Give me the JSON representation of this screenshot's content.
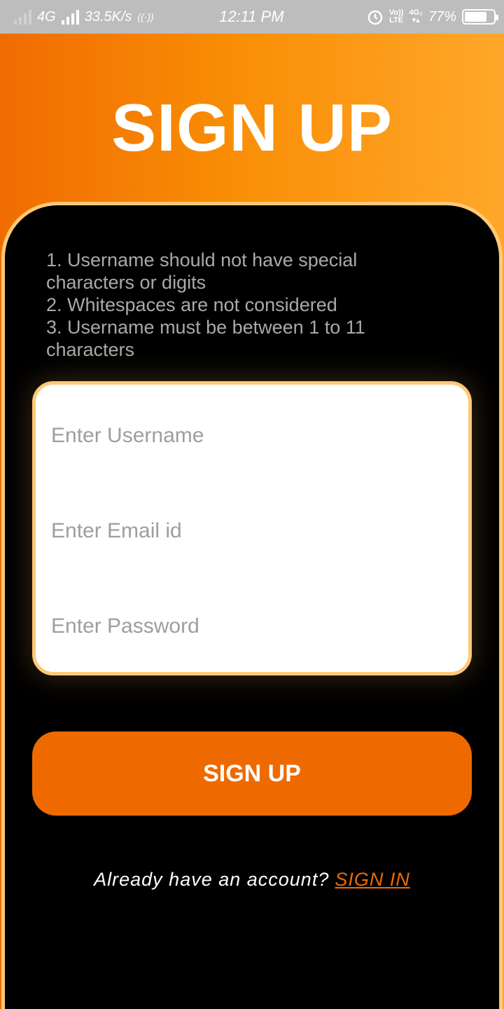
{
  "status_bar": {
    "network": "4G",
    "speed": "33.5K/s",
    "time": "12:11 PM",
    "volte_top": "Vo))",
    "volte_bottom": "LTE",
    "network2_top": "4G₂",
    "battery": "77%",
    "battery_level": 0.77
  },
  "title": "SIGN UP",
  "rules": [
    "1. Username should not have special\ncharacters or digits",
    "2. Whitespaces are not considered",
    "3. Username must be between 1 to 11\ncharacters"
  ],
  "form": {
    "username_placeholder": "Enter Username",
    "email_placeholder": "Enter Email id",
    "password_placeholder": "Enter Password"
  },
  "signup_button": "SIGN UP",
  "footer": {
    "prompt": "Already have an account?",
    "link": "SIGN IN"
  },
  "colors": {
    "accent": "#ee6a00",
    "border": "#ffc977",
    "gradient_start": "#f06c02",
    "gradient_end": "#ffa72a"
  }
}
